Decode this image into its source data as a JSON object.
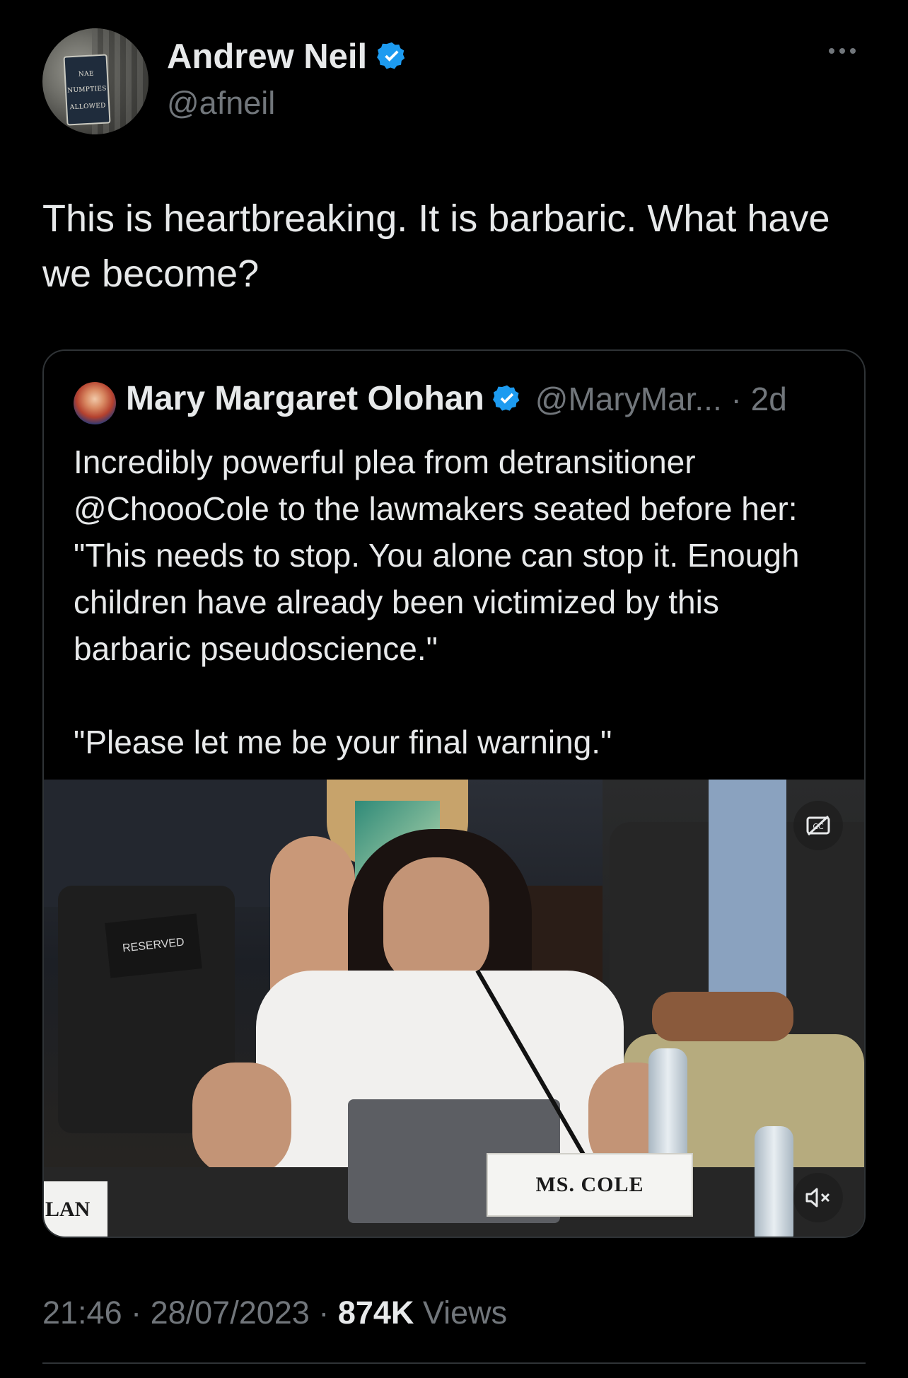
{
  "author": {
    "name": "Andrew Neil",
    "handle": "@afneil",
    "verified": true,
    "avatar_sign_lines": [
      "NAE",
      "NUMPTIES",
      "ALLOWED"
    ]
  },
  "tweet": {
    "text": "This is heartbreaking. It is barbaric. What have we become?"
  },
  "quoted": {
    "name": "Mary Margaret Olohan",
    "handle_time": "@MaryMar... · 2d",
    "text": "Incredibly powerful plea from detransitioner @ChoooCole to the lawmakers seated before her: \"This needs to stop. You alone can stop it. Enough children have already been victimized by this barbaric pseudoscience.\"\n\n\"Please let me be your final warning.\"",
    "video": {
      "nameplate": "MS. COLE",
      "nameplate_left": "LAN",
      "reserved_sign": "RESERVED"
    }
  },
  "footer": {
    "time_date": "21:46 · 28/07/2023 · ",
    "views_count": "874K",
    "views_label": " Views"
  },
  "colors": {
    "background": "#000000",
    "text": "#e7e9ea",
    "secondary": "#71767b",
    "verified": "#1d9bf0",
    "border": "#2f3336"
  }
}
